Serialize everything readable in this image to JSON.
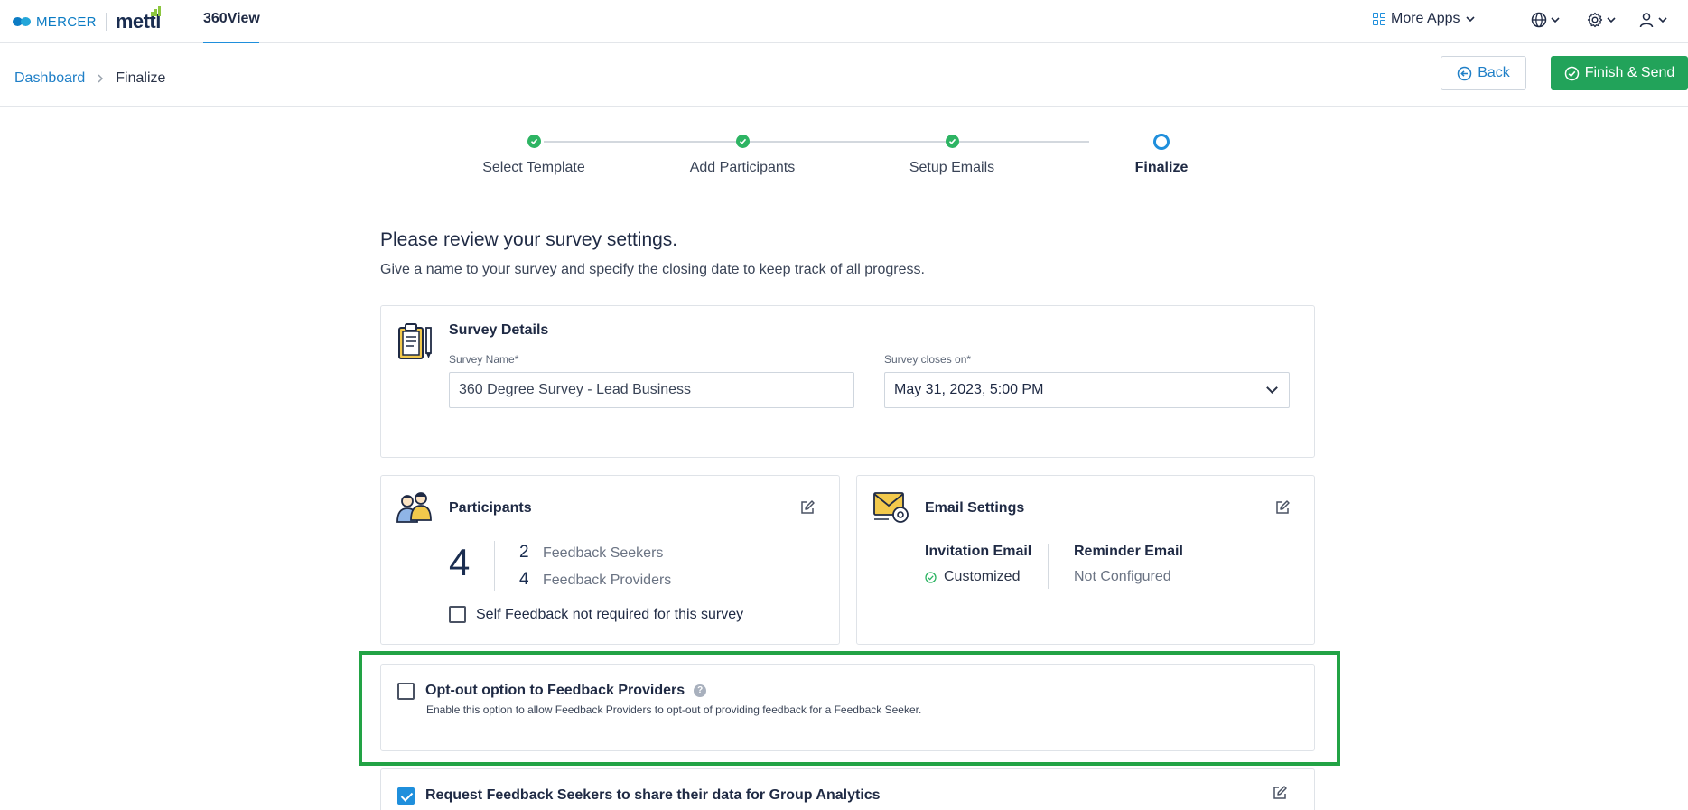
{
  "header": {
    "brand_left": "MERCER",
    "brand_right": "mettl",
    "app_tab": "360View",
    "more_apps": "More Apps"
  },
  "breadcrumb": {
    "items": [
      "Dashboard",
      "Finalize"
    ]
  },
  "actions": {
    "back": "Back",
    "finish": "Finish & Send"
  },
  "stepper": {
    "steps": [
      {
        "label": "Select Template",
        "state": "done"
      },
      {
        "label": "Add Participants",
        "state": "done"
      },
      {
        "label": "Setup Emails",
        "state": "done"
      },
      {
        "label": "Finalize",
        "state": "active"
      }
    ]
  },
  "intro": {
    "title": "Please review your survey settings.",
    "subtitle": "Give a name to your survey and specify the closing date to keep track of all progress."
  },
  "survey_details": {
    "title": "Survey Details",
    "name_label": "Survey Name*",
    "name_value": "360 Degree Survey - Lead Business",
    "closes_label": "Survey closes on*",
    "closes_value": "May 31, 2023, 5:00 PM"
  },
  "participants": {
    "title": "Participants",
    "total": "4",
    "seekers_count": "2",
    "seekers_label": "Feedback Seekers",
    "providers_count": "4",
    "providers_label": "Feedback Providers",
    "self_feedback_label": "Self Feedback not required for this survey"
  },
  "email_settings": {
    "title": "Email Settings",
    "invitation_label": "Invitation Email",
    "invitation_value": "Customized",
    "reminder_label": "Reminder Email",
    "reminder_value": "Not Configured"
  },
  "opt_out": {
    "title": "Opt-out option to Feedback Providers",
    "description": "Enable this option to allow Feedback Providers to opt-out of providing feedback for a Feedback Seeker."
  },
  "group_analytics": {
    "title": "Request Feedback Seekers to share their data for Group Analytics"
  },
  "colors": {
    "primary": "#1f8fdc",
    "success": "#22a35a",
    "highlight_border": "#22a345"
  }
}
